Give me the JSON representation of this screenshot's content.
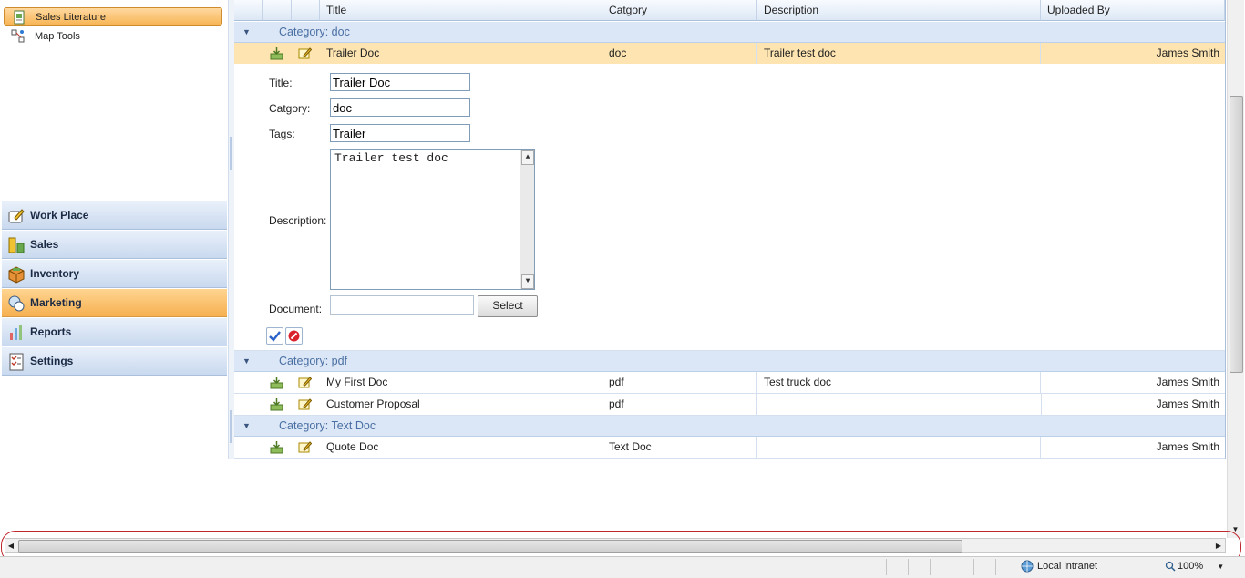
{
  "sidebar": {
    "sub_items": [
      {
        "label": "Sales Literature",
        "icon": "document-icon",
        "selected": true
      },
      {
        "label": "Map Tools",
        "icon": "map-tools-icon",
        "selected": false
      }
    ],
    "nav": [
      {
        "label": "Work Place",
        "icon": "work-place-icon"
      },
      {
        "label": "Sales",
        "icon": "sales-icon"
      },
      {
        "label": "Inventory",
        "icon": "inventory-box-icon"
      },
      {
        "label": "Marketing",
        "icon": "marketing-icon",
        "active": true
      },
      {
        "label": "Reports",
        "icon": "reports-chart-icon"
      },
      {
        "label": "Settings",
        "icon": "settings-checklist-icon"
      }
    ]
  },
  "grid": {
    "columns": [
      "Title",
      "Catgory",
      "Description",
      "Uploaded By"
    ],
    "groups": [
      {
        "label": "Category: doc",
        "rows": [
          {
            "title": "Trailer Doc",
            "category": "doc",
            "description": "Trailer test doc",
            "uploaded_by": "James Smith"
          }
        ]
      },
      {
        "label": "Category: pdf",
        "rows": [
          {
            "title": "My First Doc",
            "category": "pdf",
            "description": "Test truck doc",
            "uploaded_by": "James Smith"
          },
          {
            "title": "Customer Proposal",
            "category": "pdf",
            "description": "",
            "uploaded_by": "James Smith"
          }
        ]
      },
      {
        "label": "Category: Text Doc",
        "rows": [
          {
            "title": "Quote Doc",
            "category": "Text Doc",
            "description": "",
            "uploaded_by": "James Smith"
          }
        ]
      }
    ]
  },
  "editform": {
    "title_label": "Title:",
    "title_value": "Trailer Doc",
    "category_label": "Catgory:",
    "category_value": "doc",
    "tags_label": "Tags:",
    "tags_value": "Trailer",
    "description_label": "Description:",
    "description_value": "Trailer test doc",
    "document_label": "Document:",
    "document_value": "",
    "select_label": "Select"
  },
  "statusbar": {
    "zone": "Local intranet",
    "zoom": "100%"
  },
  "colors": {
    "accent_orange": "#f6b050",
    "header_blue": "#dbe7f6",
    "highlight_red": "#c0272d"
  }
}
